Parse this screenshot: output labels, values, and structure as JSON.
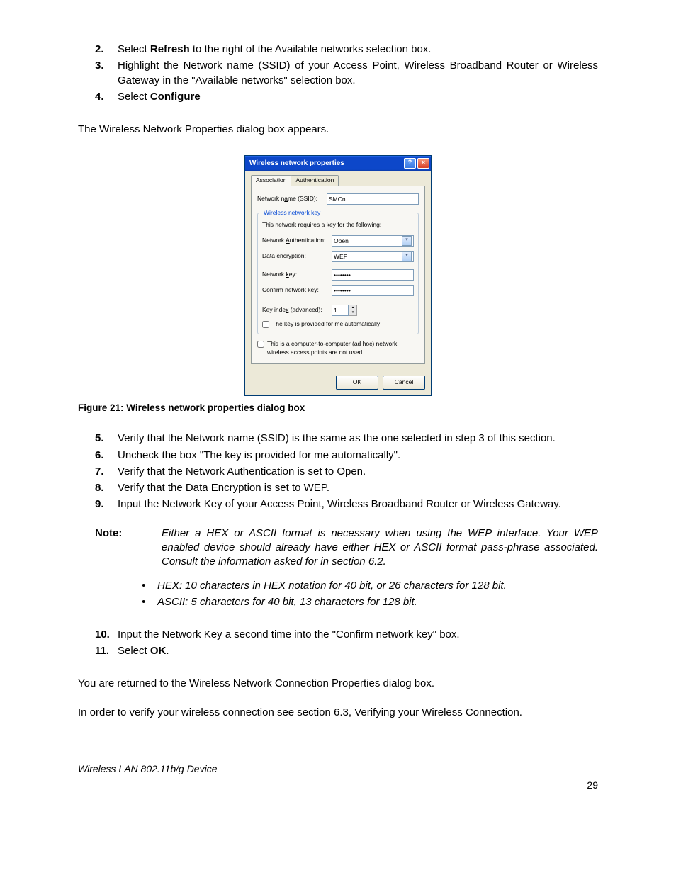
{
  "list1": [
    {
      "n": "2.",
      "pre": "Select ",
      "bold": "Refresh",
      "post": " to the right of the Available networks selection box."
    },
    {
      "n": "3.",
      "pre": "Highlight the Network name (SSID) of your Access Point, Wireless Broadband Router or Wireless Gateway in the \"Available networks\" selection box.",
      "bold": "",
      "post": ""
    },
    {
      "n": "4.",
      "pre": "Select ",
      "bold": "Configure",
      "post": ""
    }
  ],
  "para_appear": "The Wireless Network Properties dialog box appears.",
  "figure_caption": "Figure 21: Wireless network properties dialog box",
  "dialog": {
    "title": "Wireless network properties",
    "tab_assoc": "Association",
    "tab_auth": "Authentication",
    "ssid_label": "Network name (SSID):",
    "ssid_value": "SMCn",
    "group_legend": "Wireless network key",
    "group_hint": "This network requires a key for the following:",
    "auth_label": "Network Authentication:",
    "auth_value": "Open",
    "enc_label": "Data encryption:",
    "enc_value": "WEP",
    "key_label": "Network key:",
    "key_value": "••••••••",
    "confirm_label": "Confirm network key:",
    "confirm_value": "••••••••",
    "index_label": "Key index (advanced):",
    "index_value": "1",
    "auto_label": "The key is provided for me automatically",
    "adhoc_label": "This is a computer-to-computer (ad hoc) network; wireless access points are not used",
    "ok": "OK",
    "cancel": "Cancel"
  },
  "list2": [
    {
      "n": "5.",
      "text": "Verify that the Network name (SSID) is the same as the one selected in step 3 of this section."
    },
    {
      "n": "6.",
      "text": "Uncheck the box \"The key is provided for me automatically\"."
    },
    {
      "n": "7.",
      "text": "Verify that the Network Authentication is set to Open."
    },
    {
      "n": "8.",
      "text": "Verify that the Data Encryption is set to WEP."
    },
    {
      "n": "9.",
      "text": "Input the Network Key of your Access Point, Wireless Broadband Router or Wireless Gateway."
    }
  ],
  "note_label": "Note",
  "note_body": "Either a HEX or ASCII format is necessary when using the WEP interface.  Your WEP enabled device should already have either HEX or ASCII format pass-phrase associated.  Consult the information asked for in section 6.2.",
  "bullets": [
    "HEX:  10 characters in HEX notation for 40 bit, or 26 characters for 128 bit.",
    "ASCII:  5 characters for 40 bit, 13 characters for 128 bit."
  ],
  "list3": [
    {
      "n": "10.",
      "text": "Input the Network Key a second time into the \"Confirm network key\" box."
    },
    {
      "n": "11.",
      "pre": "Select ",
      "bold": "OK",
      "post": "."
    }
  ],
  "para_return": "You are returned to the Wireless Network Connection Properties dialog box.",
  "para_verify": "In order to verify your wireless connection see section 6.3, Verifying your Wireless Connection.",
  "footer_left": "Wireless LAN 802.11b/g Device",
  "footer_right": "29"
}
